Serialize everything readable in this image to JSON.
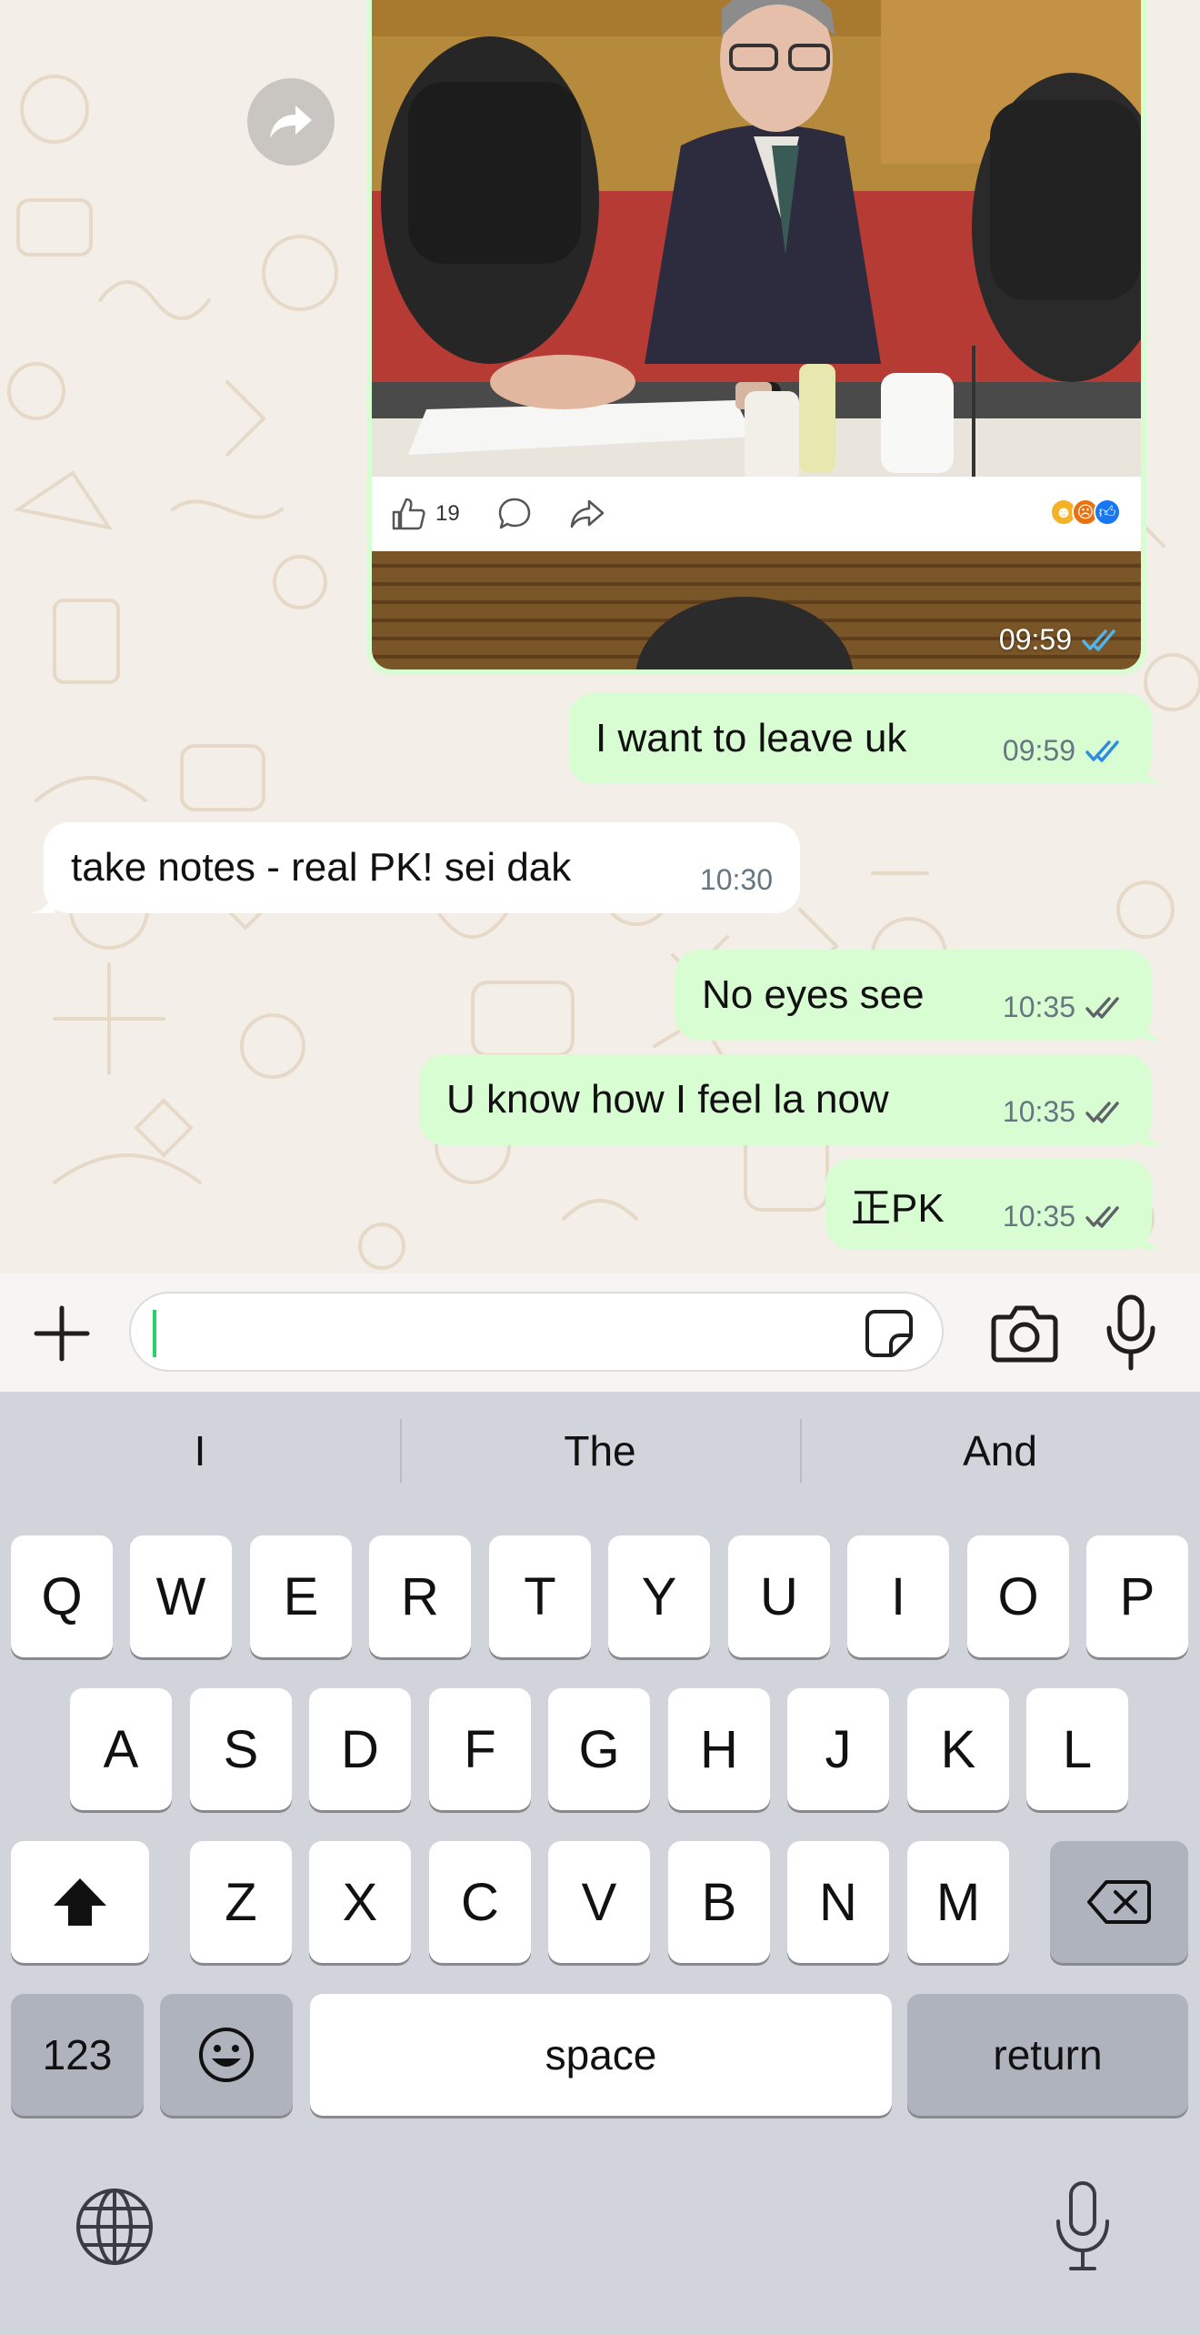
{
  "chat": {
    "media_message": {
      "like_count": "19",
      "time": "09:59"
    },
    "messages": [
      {
        "direction": "out",
        "text": "I want to leave uk",
        "time": "09:59",
        "status": "read"
      },
      {
        "direction": "in",
        "text": "take notes - real PK! sei dak",
        "time": "10:30"
      },
      {
        "direction": "out",
        "text": "No eyes see",
        "time": "10:35",
        "status": "delivered"
      },
      {
        "direction": "out",
        "text": "U know how I feel la now",
        "time": "10:35",
        "status": "delivered"
      },
      {
        "direction": "out",
        "text": "正PK",
        "time": "10:35",
        "status": "delivered"
      }
    ]
  },
  "input_bar": {
    "value": "",
    "icons": [
      "plus-icon",
      "sticker-icon",
      "camera-icon",
      "microphone-icon"
    ]
  },
  "keyboard": {
    "suggestions": [
      "I",
      "The",
      "And"
    ],
    "row1": [
      "Q",
      "W",
      "E",
      "R",
      "T",
      "Y",
      "U",
      "I",
      "O",
      "P"
    ],
    "row2": [
      "A",
      "S",
      "D",
      "F",
      "G",
      "H",
      "J",
      "K",
      "L"
    ],
    "row3": [
      "Z",
      "X",
      "C",
      "V",
      "B",
      "N",
      "M"
    ],
    "numbers_label": "123",
    "space_label": "space",
    "return_label": "return"
  },
  "colors": {
    "outgoing_bubble": "#d9fdd3",
    "incoming_bubble": "#ffffff",
    "read_ticks": "#34b7f1",
    "chat_background": "#f3efe8",
    "keyboard_background": "#d1d4db"
  }
}
